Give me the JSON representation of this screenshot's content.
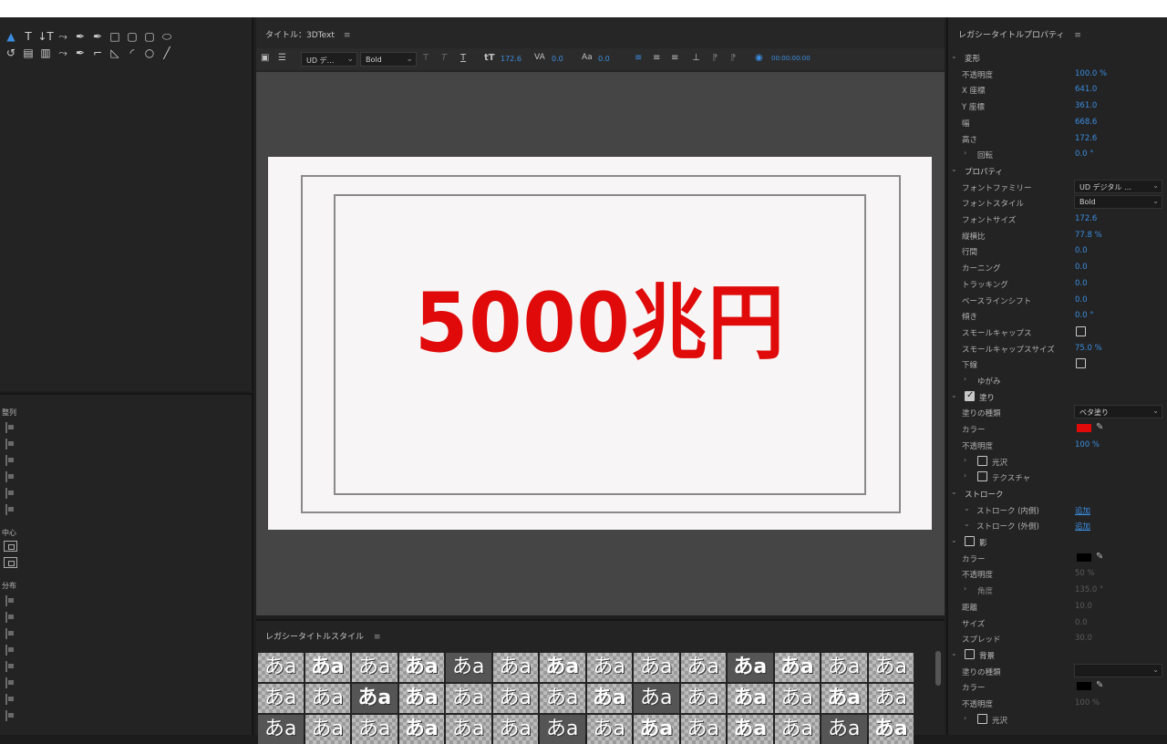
{
  "center": {
    "title": "タイトル：3DText",
    "menu_icon": "≡",
    "font_family_short": "UD デ…",
    "font_style": "Bold",
    "font_size": "172.6",
    "kerning": "0.0",
    "baseline": "0.0",
    "timecode": "00:00:00:00",
    "canvas_text": "5000兆円"
  },
  "align_panel": {
    "align_label": "整列",
    "center_label": "中心",
    "distribute_label": "分布"
  },
  "styles_panel": {
    "title": "レガシータイトルスタイル",
    "swatch_text": "あa"
  },
  "right": {
    "title": "レガシータイトルプロパティ",
    "rows": [
      {
        "type": "section",
        "label": "変形"
      },
      {
        "type": "field",
        "label": "不透明度",
        "value": "100.0 %"
      },
      {
        "type": "field",
        "label": "X 座標",
        "value": "641.0"
      },
      {
        "type": "field",
        "label": "Y 座標",
        "value": "361.0"
      },
      {
        "type": "field",
        "label": "幅",
        "value": "668.6"
      },
      {
        "type": "field",
        "label": "高さ",
        "value": "172.6"
      },
      {
        "type": "sub",
        "label": "回転",
        "value": "0.0 °"
      },
      {
        "type": "section",
        "label": "プロパティ"
      },
      {
        "type": "dropdown",
        "label": "フォントファミリー",
        "value": "UD デジタル …"
      },
      {
        "type": "dropdown",
        "label": "フォントスタイル",
        "value": "Bold"
      },
      {
        "type": "field",
        "label": "フォントサイズ",
        "value": "172.6"
      },
      {
        "type": "field",
        "label": "縦横比",
        "value": "77.8 %"
      },
      {
        "type": "field",
        "label": "行間",
        "value": "0.0"
      },
      {
        "type": "field",
        "label": "カーニング",
        "value": "0.0"
      },
      {
        "type": "field",
        "label": "トラッキング",
        "value": "0.0"
      },
      {
        "type": "field",
        "label": "ベースラインシフト",
        "value": "0.0"
      },
      {
        "type": "field",
        "label": "傾き",
        "value": "0.0 °"
      },
      {
        "type": "check",
        "label": "スモールキャップス",
        "checked": false
      },
      {
        "type": "field",
        "label": "スモールキャップスサイズ",
        "value": "75.0 %"
      },
      {
        "type": "check",
        "label": "下線",
        "checked": false
      },
      {
        "type": "sub",
        "label": "ゆがみ",
        "value": ""
      },
      {
        "type": "section-check",
        "label": "塗り",
        "checked": true
      },
      {
        "type": "dropdown",
        "label": "塗りの種類",
        "value": "ベタ塗り"
      },
      {
        "type": "color",
        "label": "カラー",
        "color": "#e00a0a"
      },
      {
        "type": "field",
        "label": "不透明度",
        "value": "100 %"
      },
      {
        "type": "sub-check",
        "label": "光沢",
        "checked": false
      },
      {
        "type": "sub-check",
        "label": "テクスチャ",
        "checked": false
      },
      {
        "type": "section",
        "label": "ストローク"
      },
      {
        "type": "link",
        "label": "ストローク (内側)",
        "value": "追加"
      },
      {
        "type": "link",
        "label": "ストローク (外側)",
        "value": "追加"
      },
      {
        "type": "section-check",
        "label": "影",
        "checked": false
      },
      {
        "type": "color",
        "label": "カラー",
        "color": "#000000"
      },
      {
        "type": "dimfield",
        "label": "不透明度",
        "value": "50 %"
      },
      {
        "type": "dimsub",
        "label": "角度",
        "value": "135.0 °"
      },
      {
        "type": "dimfield",
        "label": "距離",
        "value": "10.0"
      },
      {
        "type": "dimfield",
        "label": "サイズ",
        "value": "0.0"
      },
      {
        "type": "dimfield",
        "label": "スプレッド",
        "value": "30.0"
      },
      {
        "type": "section-check",
        "label": "背景",
        "checked": false
      },
      {
        "type": "dimdropdown",
        "label": "塗りの種類",
        "value": ""
      },
      {
        "type": "color",
        "label": "カラー",
        "color": "#000000"
      },
      {
        "type": "dimfield",
        "label": "不透明度",
        "value": "100 %"
      },
      {
        "type": "sub-check",
        "label": "光沢",
        "checked": false
      }
    ]
  }
}
